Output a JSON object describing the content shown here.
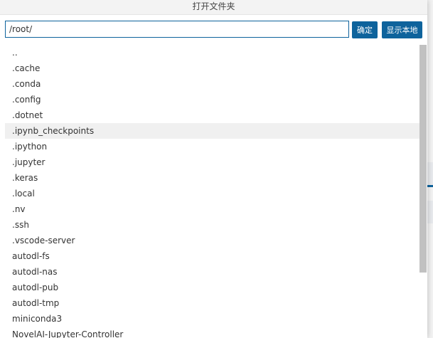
{
  "dialog": {
    "title": "打开文件夹",
    "path_value": "/root/",
    "confirm_label": "确定",
    "show_local_label": "显示本地"
  },
  "files": [
    "..",
    ".cache",
    ".conda",
    ".config",
    ".dotnet",
    ".ipynb_checkpoints",
    ".ipython",
    ".jupyter",
    ".keras",
    ".local",
    ".nv",
    ".ssh",
    ".vscode-server",
    "autodl-fs",
    "autodl-nas",
    "autodl-pub",
    "autodl-tmp",
    "miniconda3",
    "NovelAI-Jupyter-Controller"
  ],
  "hovered_item": ".ipynb_checkpoints",
  "colors": {
    "accent": "#0e639c",
    "hover_row": "#f0f0f0",
    "background": "#f3f3f3"
  }
}
